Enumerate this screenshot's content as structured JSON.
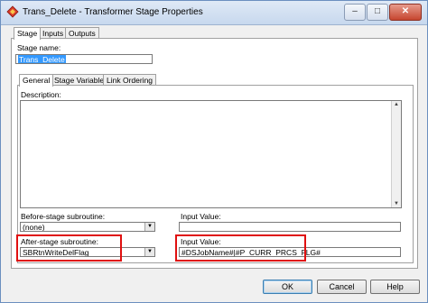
{
  "window": {
    "title": "Trans_Delete - Transformer Stage Properties",
    "controls": {
      "minimize": "–",
      "maximize": "□",
      "close": "✕"
    }
  },
  "top_tabs": [
    {
      "label": "Stage",
      "active": true
    },
    {
      "label": "Inputs",
      "active": false
    },
    {
      "label": "Outputs",
      "active": false
    }
  ],
  "stage": {
    "name_label": "Stage name:",
    "name_value": "Trans_Delete"
  },
  "inner_tabs": [
    {
      "label": "General",
      "active": true
    },
    {
      "label": "Stage Variables",
      "active": false
    },
    {
      "label": "Link Ordering",
      "active": false
    }
  ],
  "general": {
    "description_label": "Description:",
    "before_label": "Before-stage subroutine:",
    "before_value": "(none)",
    "before_input_label": "Input Value:",
    "before_input_value": "",
    "after_label": "After-stage subroutine:",
    "after_value": "SBRtnWriteDelFlag",
    "after_input_label": "Input Value:",
    "after_input_value": "#DSJobName#|#P_CURR_PRCS_FLG#"
  },
  "buttons": {
    "ok": "OK",
    "cancel": "Cancel",
    "help": "Help"
  },
  "highlight_color": "#e01010"
}
